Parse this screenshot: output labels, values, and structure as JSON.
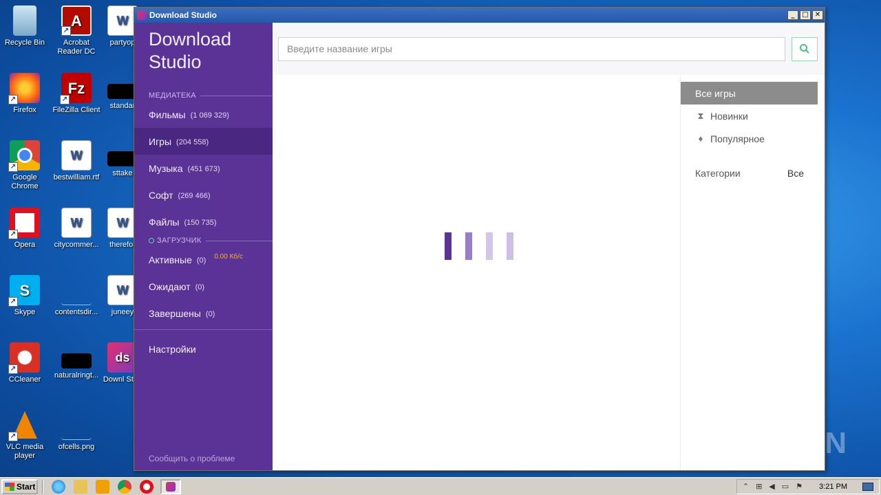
{
  "desktop": {
    "icons": [
      {
        "label": "Recycle Bin",
        "icon": "recycle-bin-icon"
      },
      {
        "label": "Acrobat Reader DC",
        "icon": "acrobat-icon"
      },
      {
        "label": "partyop",
        "icon": "word-doc-icon"
      },
      {
        "label": "Firefox",
        "icon": "firefox-icon"
      },
      {
        "label": "FileZilla Client",
        "icon": "filezilla-icon"
      },
      {
        "label": "standar",
        "icon": "file-icon"
      },
      {
        "label": "Google Chrome",
        "icon": "chrome-icon"
      },
      {
        "label": "bestwilliam.rtf",
        "icon": "word-doc-icon"
      },
      {
        "label": "sttake",
        "icon": "file-icon"
      },
      {
        "label": "Opera",
        "icon": "opera-icon"
      },
      {
        "label": "citycommer...",
        "icon": "word-doc-icon"
      },
      {
        "label": "therefor",
        "icon": "word-doc-icon"
      },
      {
        "label": "Skype",
        "icon": "skype-icon"
      },
      {
        "label": "contentsdir...",
        "icon": "file-icon"
      },
      {
        "label": "juneey",
        "icon": "word-doc-icon"
      },
      {
        "label": "CCleaner",
        "icon": "ccleaner-icon"
      },
      {
        "label": "naturalringt...",
        "icon": "file-icon"
      },
      {
        "label": "Downl Stud",
        "icon": "download-studio-icon"
      },
      {
        "label": "VLC media player",
        "icon": "vlc-icon"
      },
      {
        "label": "ofcells.png",
        "icon": "file-icon"
      }
    ],
    "watermark": "ANY RUN"
  },
  "window": {
    "title": "Download Studio",
    "controls": {
      "minimize": "_",
      "maximize": "□",
      "close": "✕"
    }
  },
  "sidebar": {
    "brand_line1": "Download",
    "brand_line2": "Studio",
    "library_header": "МЕДИАТЕКА",
    "library_items": [
      {
        "label": "Фильмы",
        "count": "(1 069 329)"
      },
      {
        "label": "Игры",
        "count": "(204 558)",
        "active": true
      },
      {
        "label": "Музыка",
        "count": "(451 673)"
      },
      {
        "label": "Софт",
        "count": "(269 466)"
      },
      {
        "label": "Файлы",
        "count": "(150 735)"
      }
    ],
    "loader_header": "ЗАГРУЗЧИК",
    "loader_items": [
      {
        "label": "Активные",
        "count": "(0)",
        "speed": "0.00 Кб/с"
      },
      {
        "label": "Ожидают",
        "count": "(0)"
      },
      {
        "label": "Завершены",
        "count": "(0)"
      }
    ],
    "settings": "Настройки",
    "report": "Сообщить о проблеме"
  },
  "search": {
    "placeholder": "Введите название игры",
    "value": ""
  },
  "filters": {
    "all": "Все игры",
    "new": "Новинки",
    "popular": "Популярное",
    "categories_label": "Категории",
    "categories_value": "Все"
  },
  "loader_colors": [
    "#5b3396",
    "#9b7cc6",
    "#d3c6e8",
    "#cdbfe5"
  ],
  "taskbar": {
    "start": "Start",
    "clock": "3:21 PM"
  }
}
